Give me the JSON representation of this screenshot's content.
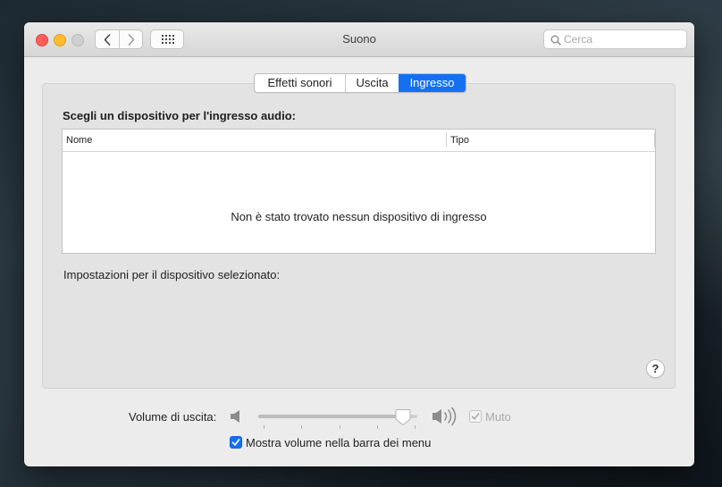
{
  "window": {
    "title": "Suono",
    "search": {
      "placeholder": "Cerca",
      "value": ""
    }
  },
  "tabs": [
    {
      "label": "Effetti sonori",
      "selected": false
    },
    {
      "label": "Uscita",
      "selected": false
    },
    {
      "label": "Ingresso",
      "selected": true
    }
  ],
  "input_panel": {
    "heading": "Scegli un dispositivo per l'ingresso audio:",
    "columns": [
      "Nome",
      "Tipo"
    ],
    "rows": [],
    "empty_message": "Non è stato trovato nessun dispositivo di ingresso",
    "settings_label": "Impostazioni per il dispositivo selezionato:",
    "help": "?"
  },
  "output_volume": {
    "label": "Volume di uscita:",
    "level": 0.91,
    "mute_label": "Muto",
    "mute_checked": true,
    "show_in_menubar_label": "Mostra volume nella barra dei menu",
    "show_in_menubar_checked": true
  },
  "colors": {
    "accent": "#1570f0",
    "close": "#ff5f57",
    "minimize": "#febc2e"
  },
  "icons": [
    "back-icon",
    "forward-icon",
    "grid-icon",
    "search-icon",
    "speaker-low-icon",
    "speaker-high-icon",
    "checkmark-icon",
    "help-icon"
  ]
}
